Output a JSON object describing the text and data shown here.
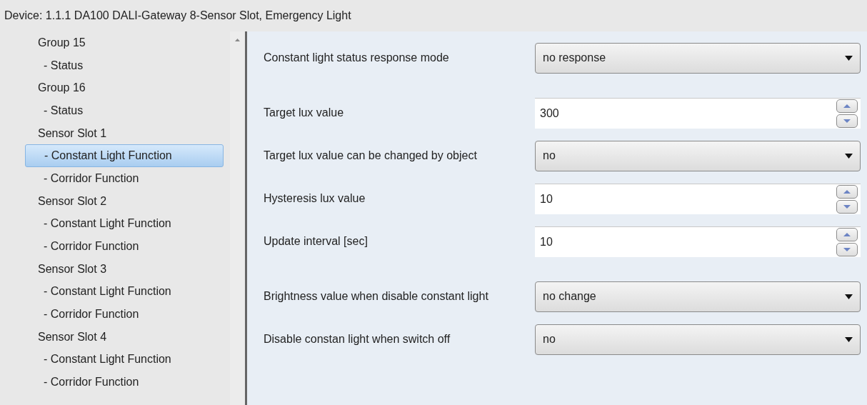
{
  "window": {
    "title": "Device: 1.1.1  DA100 DALI-Gateway 8-Sensor Slot, Emergency Light"
  },
  "tree": [
    {
      "label": "Group 15",
      "selected": false,
      "children": [
        {
          "label": "- Status",
          "selected": false
        }
      ]
    },
    {
      "label": "Group 16",
      "selected": false,
      "children": [
        {
          "label": "- Status",
          "selected": false
        }
      ]
    },
    {
      "label": "Sensor Slot 1",
      "selected": false,
      "children": [
        {
          "label": "- Constant Light Function",
          "selected": true
        },
        {
          "label": "- Corridor Function",
          "selected": false
        }
      ]
    },
    {
      "label": "Sensor Slot 2",
      "selected": false,
      "children": [
        {
          "label": "- Constant Light Function",
          "selected": false
        },
        {
          "label": "- Corridor Function",
          "selected": false
        }
      ]
    },
    {
      "label": "Sensor Slot 3",
      "selected": false,
      "children": [
        {
          "label": "- Constant Light Function",
          "selected": false
        },
        {
          "label": "- Corridor Function",
          "selected": false
        }
      ]
    },
    {
      "label": "Sensor Slot 4",
      "selected": false,
      "children": [
        {
          "label": "- Constant Light Function",
          "selected": false
        },
        {
          "label": "- Corridor Function",
          "selected": false
        }
      ]
    }
  ],
  "sections": [
    [
      {
        "kind": "dropdown",
        "label": "Constant light status response mode",
        "value": "no response"
      }
    ],
    [
      {
        "kind": "spin",
        "label": "Target lux value",
        "value": "300"
      },
      {
        "kind": "dropdown",
        "label": "Target lux value can be changed by object",
        "value": "no"
      },
      {
        "kind": "spin",
        "label": "Hysteresis lux value",
        "value": "10"
      },
      {
        "kind": "spin",
        "label": "Update interval [sec]",
        "value": "10"
      }
    ],
    [
      {
        "kind": "dropdown",
        "label": "Brightness value when disable constant light",
        "value": "no change"
      },
      {
        "kind": "dropdown",
        "label": "Disable constan light when switch off",
        "value": "no"
      }
    ]
  ]
}
